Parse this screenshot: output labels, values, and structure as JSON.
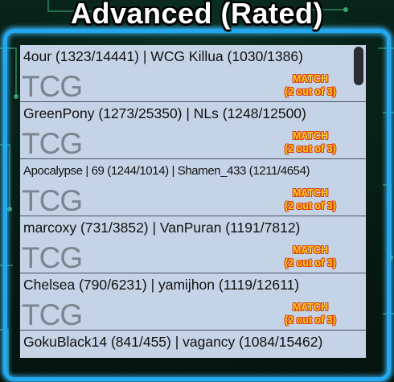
{
  "title": "Advanced (Rated)",
  "colors": {
    "frame": "#22a8f0",
    "row_bg": "#c5d3e6",
    "match_text": "#ffd21e",
    "match_outline": "#d83a10"
  },
  "games": [
    {
      "players": "4our (1323/14441) | WCG Killua (1030/1386)",
      "format": "TCG",
      "match_label": "MATCH",
      "match_count": "(2 out of 3)"
    },
    {
      "players": "GreenPony (1273/25350) | NLs (1248/12500)",
      "format": "TCG",
      "match_label": "MATCH",
      "match_count": "(2 out of 3)"
    },
    {
      "players": "Apocalypse | 69 (1244/1014) | Shamen_433 (1211/4654)",
      "format": "TCG",
      "match_label": "MATCH",
      "match_count": "(2 out of 3)"
    },
    {
      "players": "marcoxy (731/3852) | VanPuran (1191/7812)",
      "format": "TCG",
      "match_label": "MATCH",
      "match_count": "(2 out of 3)"
    },
    {
      "players": "Chelsea (790/6231) | yamijhon (1119/12611)",
      "format": "TCG",
      "match_label": "MATCH",
      "match_count": "(2 out of 3)"
    },
    {
      "players": "GokuBlack14 (841/455) | vagancy (1084/15462)",
      "format": "",
      "match_label": "",
      "match_count": ""
    }
  ]
}
